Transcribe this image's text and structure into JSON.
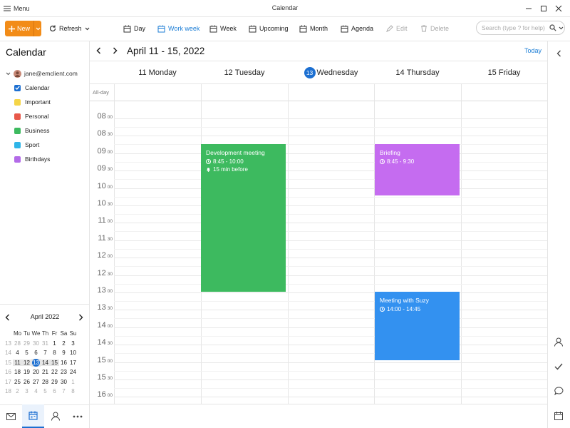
{
  "window": {
    "menu_label": "Menu",
    "title": "Calendar"
  },
  "toolbar": {
    "new_label": "New",
    "refresh_label": "Refresh",
    "views": [
      {
        "label": "Day"
      },
      {
        "label": "Work week"
      },
      {
        "label": "Week"
      },
      {
        "label": "Upcoming"
      },
      {
        "label": "Month"
      },
      {
        "label": "Agenda"
      },
      {
        "label": "Edit"
      },
      {
        "label": "Delete"
      }
    ],
    "active_view": "Work week",
    "search_placeholder": "Search (type ? for help)"
  },
  "sidebar": {
    "heading": "Calendar",
    "account": "jane@emclient.com",
    "calendars": [
      {
        "label": "Calendar",
        "color": "#1c6fd1",
        "checked": true
      },
      {
        "label": "Important",
        "color": "#f5d547",
        "checked": false
      },
      {
        "label": "Personal",
        "color": "#e8584a",
        "checked": false
      },
      {
        "label": "Business",
        "color": "#3dba5f",
        "checked": false
      },
      {
        "label": "Sport",
        "color": "#2fb5e8",
        "checked": false
      },
      {
        "label": "Birthdays",
        "color": "#b36be8",
        "checked": false
      }
    ]
  },
  "mini_calendar": {
    "month_label": "April 2022",
    "weekdays": [
      "Mo",
      "Tu",
      "We",
      "Th",
      "Fr",
      "Sa",
      "Su"
    ],
    "weeks": [
      {
        "wk": "13",
        "days": [
          "28",
          "29",
          "30",
          "31",
          "1",
          "2",
          "3"
        ]
      },
      {
        "wk": "14",
        "days": [
          "4",
          "5",
          "6",
          "7",
          "8",
          "9",
          "10"
        ]
      },
      {
        "wk": "15",
        "days": [
          "11",
          "12",
          "13",
          "14",
          "15",
          "16",
          "17"
        ]
      },
      {
        "wk": "16",
        "days": [
          "18",
          "19",
          "20",
          "21",
          "22",
          "23",
          "24"
        ]
      },
      {
        "wk": "17",
        "days": [
          "25",
          "26",
          "27",
          "28",
          "29",
          "30",
          "1"
        ]
      },
      {
        "wk": "18",
        "days": [
          "2",
          "3",
          "4",
          "5",
          "6",
          "7",
          "8"
        ]
      }
    ],
    "today": "13"
  },
  "main": {
    "range_label": "April 11 - 15, 2022",
    "today_label": "Today",
    "allday_label": "All-day",
    "days": [
      {
        "num": "11",
        "name": "Monday"
      },
      {
        "num": "12",
        "name": "Tuesday"
      },
      {
        "num": "13",
        "name": "Wednesday"
      },
      {
        "num": "14",
        "name": "Thursday"
      },
      {
        "num": "15",
        "name": "Friday"
      }
    ],
    "hours": [
      {
        "h": "08",
        "m": "00"
      },
      {
        "h": "08",
        "m": "30"
      },
      {
        "h": "09",
        "m": "00"
      },
      {
        "h": "09",
        "m": "30"
      },
      {
        "h": "10",
        "m": "00"
      },
      {
        "h": "10",
        "m": "30"
      },
      {
        "h": "11",
        "m": "00"
      },
      {
        "h": "11",
        "m": "30"
      },
      {
        "h": "12",
        "m": "00"
      },
      {
        "h": "12",
        "m": "30"
      },
      {
        "h": "13",
        "m": "00"
      },
      {
        "h": "13",
        "m": "30"
      },
      {
        "h": "14",
        "m": "00"
      },
      {
        "h": "14",
        "m": "30"
      },
      {
        "h": "15",
        "m": "00"
      },
      {
        "h": "15",
        "m": "30"
      },
      {
        "h": "16",
        "m": "00"
      }
    ],
    "events": [
      {
        "title": "Development meeting",
        "time": "8:45 - 10:00",
        "reminder": "15 min before",
        "color": "#3dba5f"
      },
      {
        "title": "Briefing",
        "time": "8:45 - 9:30",
        "reminder": "",
        "color": "#c56cf0"
      },
      {
        "title": "Meeting with Suzy",
        "time": "14:00 - 14:45",
        "reminder": "",
        "color": "#3391f0"
      }
    ]
  }
}
